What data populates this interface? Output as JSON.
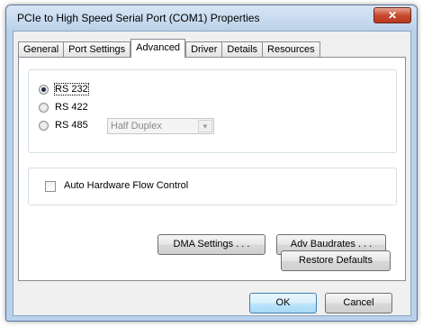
{
  "window": {
    "title": "PCIe to High Speed Serial Port (COM1) Properties",
    "close_glyph": "✕"
  },
  "tabs": [
    {
      "label": "General"
    },
    {
      "label": "Port Settings"
    },
    {
      "label": "Advanced",
      "active": true
    },
    {
      "label": "Driver"
    },
    {
      "label": "Details"
    },
    {
      "label": "Resources"
    }
  ],
  "advanced": {
    "mode_radios": [
      {
        "label": "RS 232",
        "checked": true
      },
      {
        "label": "RS 422",
        "checked": false
      },
      {
        "label": "RS 485",
        "checked": false
      }
    ],
    "duplex_select": {
      "value": "Half Duplex",
      "enabled": false
    },
    "auto_flow_control": {
      "label": "Auto Hardware Flow Control",
      "checked": false
    },
    "dma_settings_label": "DMA Settings . . .",
    "adv_baudrates_label": "Adv Baudrates . . .",
    "restore_defaults_label": "Restore Defaults"
  },
  "footer": {
    "ok_label": "OK",
    "cancel_label": "Cancel"
  }
}
